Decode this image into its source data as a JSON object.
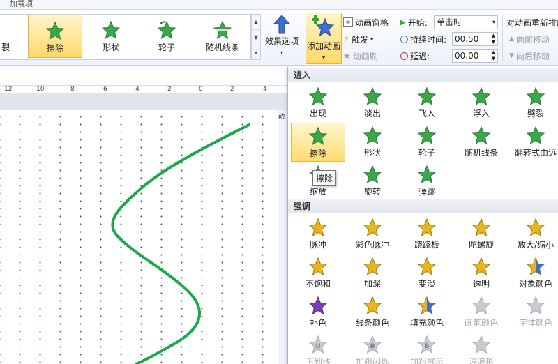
{
  "app": {
    "tab_partial": "加载项"
  },
  "gallery": {
    "partial_label": "裂",
    "items": [
      {
        "label": "擦除",
        "icon": "wipe-star-icon",
        "selected": true
      },
      {
        "label": "形状",
        "icon": "shape-star-icon",
        "selected": false
      },
      {
        "label": "轮子",
        "icon": "wheel-star-icon",
        "selected": false
      },
      {
        "label": "随机线条",
        "icon": "random-bars-star-icon",
        "selected": false
      }
    ]
  },
  "ribbon": {
    "effect_options": "效果选项",
    "add_animation": "添加动画",
    "animation_pane": "动画窗格",
    "trigger": "触发",
    "animation_painter": "动画刷",
    "start_label": "开始:",
    "start_value": "单击时",
    "duration_label": "持续时间:",
    "duration_value": "00.50",
    "delay_label": "延迟:",
    "delay_value": "00.00",
    "reorder_title": "对动画重新排序",
    "move_earlier": "向前移动",
    "move_later": "向后移动"
  },
  "ruler": {
    "labels": [
      "12",
      "10",
      "8",
      "6",
      "4",
      "2",
      "0",
      "2",
      "4"
    ]
  },
  "side_panel_char": "动",
  "dropdown": {
    "entrance_header": "进入",
    "entrance": [
      {
        "label": "出现",
        "icon": "appear-star-icon"
      },
      {
        "label": "淡出",
        "icon": "fade-star-icon"
      },
      {
        "label": "飞入",
        "icon": "fly-in-star-icon"
      },
      {
        "label": "浮入",
        "icon": "float-in-star-icon"
      },
      {
        "label": "劈裂",
        "icon": "split-star-icon"
      },
      {
        "label": "擦除",
        "icon": "wipe-star-icon"
      },
      {
        "label": "形状",
        "icon": "shape-star-icon"
      },
      {
        "label": "轮子",
        "icon": "wheel-star-icon"
      },
      {
        "label": "随机线条",
        "icon": "random-bars-star-icon"
      },
      {
        "label": "翻转式由远",
        "icon": "grow-turn-star-icon"
      },
      {
        "label": "缩放",
        "icon": "zoom-star-icon"
      },
      {
        "label": "旋转",
        "icon": "swivel-star-icon"
      },
      {
        "label": "弹跳",
        "icon": "bounce-star-icon"
      }
    ],
    "emphasis_header": "强调",
    "emphasis": [
      {
        "label": "脉冲",
        "icon": "pulse-star-icon"
      },
      {
        "label": "彩色脉冲",
        "icon": "color-pulse-star-icon"
      },
      {
        "label": "跷跷板",
        "icon": "teeter-star-icon"
      },
      {
        "label": "陀螺旋",
        "icon": "spin-star-icon"
      },
      {
        "label": "放大/缩小",
        "icon": "grow-shrink-star-icon"
      },
      {
        "label": "不饱和",
        "icon": "desaturate-star-icon"
      },
      {
        "label": "加深",
        "icon": "darken-star-icon"
      },
      {
        "label": "变淡",
        "icon": "lighten-star-icon"
      },
      {
        "label": "透明",
        "icon": "transparency-star-icon"
      },
      {
        "label": "对象颜色",
        "icon": "object-color-star-icon"
      },
      {
        "label": "补色",
        "icon": "complementary-color-star-icon"
      },
      {
        "label": "线条颜色",
        "icon": "line-color-star-icon"
      },
      {
        "label": "填充颜色",
        "icon": "fill-color-star-icon"
      },
      {
        "label": "画笔颜色",
        "icon": "brush-color-star-icon"
      },
      {
        "label": "字体颜色",
        "icon": "font-color-star-icon"
      },
      {
        "label": "下划线",
        "icon": "underline-star-icon"
      },
      {
        "label": "加粗闪烁",
        "icon": "bold-flash-star-icon"
      },
      {
        "label": "加粗展示",
        "icon": "bold-reveal-star-icon"
      },
      {
        "label": "波浪形",
        "icon": "wave-star-icon"
      }
    ]
  },
  "tooltip": "擦除",
  "colors": {
    "entrance_green": "#3aa84a",
    "emphasis_gold": "#e8b420",
    "disabled_gray": "#c7ccd2",
    "curve_green": "#1aa84c",
    "accent_blue": "#3d6fd0"
  }
}
